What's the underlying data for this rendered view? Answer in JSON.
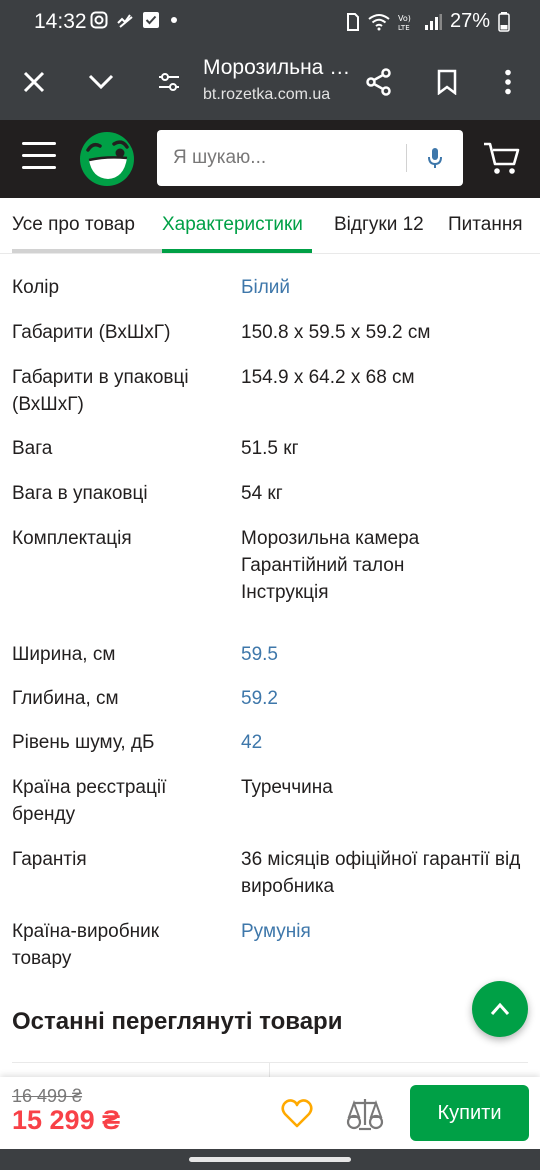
{
  "status_bar": {
    "time": "14:32",
    "left_icons": [
      "instagram-icon",
      "activity-icon",
      "check-icon",
      "dot-icon"
    ],
    "battery": "27%"
  },
  "browser": {
    "title": "Морозильна камера",
    "url": "bt.rozetka.com.ua"
  },
  "header": {
    "search_placeholder": "Я шукаю...",
    "brand_color": "#00a046"
  },
  "tabs": [
    {
      "label": "Усе про товар"
    },
    {
      "label": "Характеристики",
      "active": true
    },
    {
      "label": "Відгуки 12"
    },
    {
      "label": "Питання"
    }
  ],
  "specs": [
    {
      "label": [
        "Колір"
      ],
      "value": [
        "Білий"
      ],
      "link": true
    },
    {
      "label": [
        "Габарити (ВхШхГ)"
      ],
      "value": [
        "150.8 x 59.5 x 59.2 см"
      ],
      "link": false
    },
    {
      "label": [
        "Габарити в упаковці",
        "(ВхШхГ)"
      ],
      "value": [
        "154.9 x 64.2 x 68 см"
      ],
      "link": false
    },
    {
      "label": [
        "Вага"
      ],
      "value": [
        "51.5 кг"
      ],
      "link": false
    },
    {
      "label": [
        "Вага в упаковці"
      ],
      "value": [
        "54 кг"
      ],
      "link": false
    },
    {
      "label": [
        "Комплектація"
      ],
      "value": [
        "Морозильна камера",
        "Гарантійний талон",
        "Інструкція"
      ],
      "link": false
    },
    {
      "label": [
        "Ширина, см"
      ],
      "value": [
        "59.5"
      ],
      "link": true
    },
    {
      "label": [
        "Глибина, см"
      ],
      "value": [
        "59.2"
      ],
      "link": true
    },
    {
      "label": [
        "Рівень шуму, дБ"
      ],
      "value": [
        "42"
      ],
      "link": true
    },
    {
      "label": [
        "Країна реєстрації",
        "бренду"
      ],
      "value": [
        "Туреччина"
      ],
      "link": false
    },
    {
      "label": [
        "Гарантія"
      ],
      "value": [
        "36 місяців офіційної гарантії від",
        "виробника"
      ],
      "link": false
    },
    {
      "label": [
        "Країна-виробник",
        "товару"
      ],
      "value": [
        "Румунія"
      ],
      "link": true
    }
  ],
  "recently_viewed": {
    "title": "Останні переглянуті товари"
  },
  "buy_bar": {
    "old_price": "16 499 ₴",
    "price": "15 299 ₴",
    "buy_label": "Купити",
    "price_color": "#f84147",
    "wish_color": "#ffa900"
  }
}
